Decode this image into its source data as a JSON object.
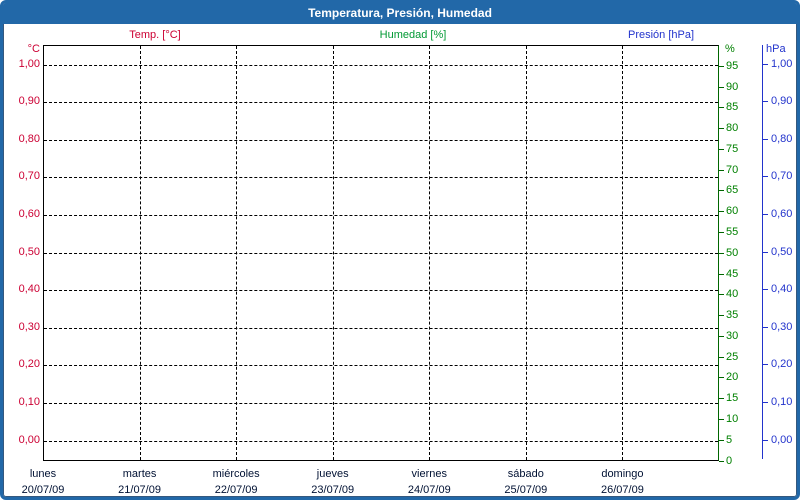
{
  "window_title": "Temperatura, Presión, Humedad",
  "colors": {
    "frame": "#2268a8",
    "temperature": "#cc0033",
    "humidity_legend": "#009933",
    "humidity_ticks": "#008000",
    "humidity_axis_line": "#006600",
    "pressure": "#2233cc",
    "day_label": "#001133",
    "grid": "#000000"
  },
  "legend": {
    "items": [
      {
        "label": "Temp. [°C]",
        "color": "#cc0033"
      },
      {
        "label": "Humedad [%]",
        "color": "#009933"
      },
      {
        "label": "Presión [hPa]",
        "color": "#2233cc"
      }
    ]
  },
  "chart_data": {
    "type": "line",
    "title": "Temperatura, Presión, Humedad",
    "grid": "black dashed; horizontal line per 0,10 of left axis; vertical line at each day boundary",
    "legend_position": "top",
    "axes": {
      "left_temperature": {
        "unit": "°C",
        "ticks": [
          "1,00",
          "0,90",
          "0,80",
          "0,70",
          "0,60",
          "0,50",
          "0,40",
          "0,30",
          "0,20",
          "0,10",
          "0,00"
        ],
        "range_top_to_bottom": [
          1.0,
          0.0
        ]
      },
      "right_humidity": {
        "unit": "%",
        "ticks": [
          "95",
          "90",
          "85",
          "80",
          "75",
          "70",
          "65",
          "60",
          "55",
          "50",
          "45",
          "40",
          "35",
          "30",
          "25",
          "20",
          "15",
          "10",
          "5",
          "0"
        ],
        "range": [
          0,
          100
        ],
        "tick_step": 5
      },
      "right_pressure": {
        "unit": "hPa",
        "ticks": [
          "1,00",
          "0,90",
          "0,80",
          "0,70",
          "0,60",
          "0,50",
          "0,40",
          "0,30",
          "0,20",
          "0,10",
          "0,00"
        ],
        "range_top_to_bottom": [
          1.0,
          0.0
        ]
      },
      "x_days": [
        {
          "name": "lunes",
          "date": "20/07/09"
        },
        {
          "name": "martes",
          "date": "21/07/09"
        },
        {
          "name": "miércoles",
          "date": "22/07/09"
        },
        {
          "name": "jueves",
          "date": "23/07/09"
        },
        {
          "name": "viernes",
          "date": "24/07/09"
        },
        {
          "name": "sábado",
          "date": "25/07/09"
        },
        {
          "name": "domingo",
          "date": "26/07/09"
        }
      ]
    },
    "series": [
      {
        "name": "Temp. [°C]",
        "axis": "left_temperature",
        "color": "#cc0033",
        "values": []
      },
      {
        "name": "Humedad [%]",
        "axis": "right_humidity",
        "color": "#009933",
        "values": []
      },
      {
        "name": "Presión [hPa]",
        "axis": "right_pressure",
        "color": "#2233cc",
        "values": []
      }
    ],
    "note": "empty plot grid — no data points are drawn for the shown week"
  }
}
